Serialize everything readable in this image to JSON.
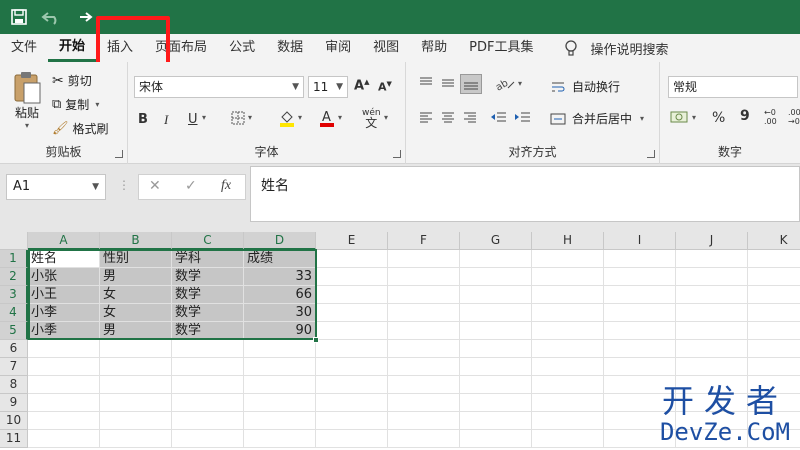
{
  "tabs": [
    "文件",
    "开始",
    "插入",
    "页面布局",
    "公式",
    "数据",
    "审阅",
    "视图",
    "帮助",
    "PDF工具集"
  ],
  "active_tab": "开始",
  "search_label": "操作说明搜索",
  "ribbon": {
    "clipboard": {
      "paste": "粘贴",
      "cut": "剪切",
      "copy": "复制",
      "format_painter": "格式刷",
      "label": "剪贴板"
    },
    "font": {
      "font_name": "宋体",
      "font_size": "11",
      "bold": "B",
      "italic": "I",
      "underline": "U",
      "label": "字体"
    },
    "alignment": {
      "wrap": "自动换行",
      "merge": "合并后居中",
      "label": "对齐方式"
    },
    "number": {
      "format": "常规",
      "percent": "%",
      "comma": "9",
      "label": "数字"
    }
  },
  "formula_bar": {
    "name_box": "A1",
    "fx": "fx",
    "content": "姓名"
  },
  "columns": [
    "A",
    "B",
    "C",
    "D",
    "E",
    "F",
    "G",
    "H",
    "I",
    "J",
    "K"
  ],
  "rows": [
    "1",
    "2",
    "3",
    "4",
    "5",
    "6",
    "7",
    "8",
    "9",
    "10",
    "11"
  ],
  "table": {
    "header": [
      "姓名",
      "性别",
      "学科",
      "成绩"
    ],
    "rows": [
      [
        "小张",
        "男",
        "数学",
        "33"
      ],
      [
        "小王",
        "女",
        "数学",
        "66"
      ],
      [
        "小李",
        "女",
        "数学",
        "30"
      ],
      [
        "小季",
        "男",
        "数学",
        "90"
      ]
    ]
  },
  "watermark": {
    "line1": "开发者",
    "line2": "DevZe.CoM"
  },
  "colors": {
    "accent": "#217346",
    "highlight": "#ff1a1a",
    "watermark": "#1e4fa3"
  }
}
